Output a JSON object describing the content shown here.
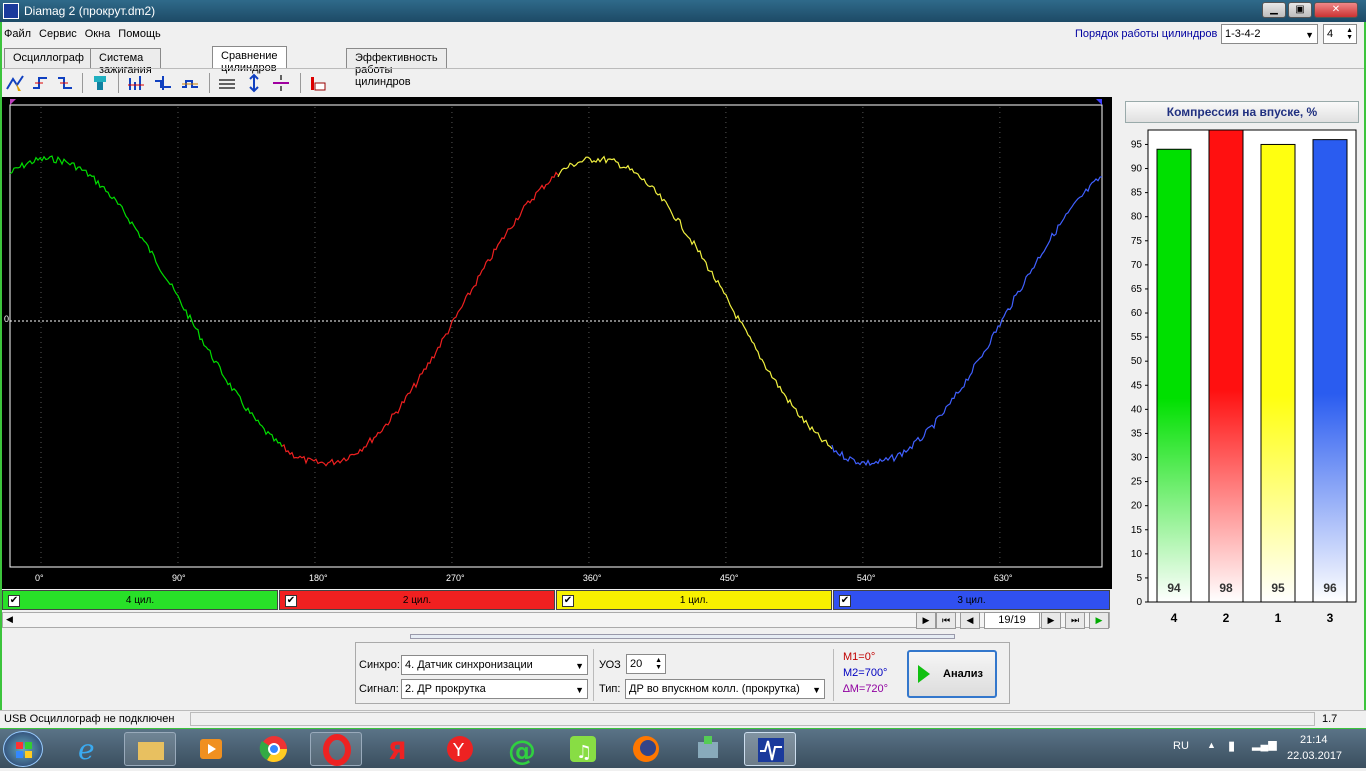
{
  "window": {
    "title": "Diamag 2 (прокрут.dm2)"
  },
  "menu": [
    "Файл",
    "Сервис",
    "Окна",
    "Помощь"
  ],
  "firing_order": {
    "label": "Порядок работы цилиндров",
    "value": "1-3-4-2",
    "count": "4"
  },
  "tabs": [
    "Осциллограф",
    "Система зажигания",
    "Сравнение цилиндров",
    "Эффективность работы цилиндров"
  ],
  "active_tab": 2,
  "scope": {
    "zero_label": "0",
    "angle_ticks": [
      "0°",
      "90°",
      "180°",
      "270°",
      "360°",
      "450°",
      "540°",
      "630°"
    ],
    "cylinders": [
      {
        "label": "4 цил.",
        "color": "#00dd00",
        "bar": "#28e028"
      },
      {
        "label": "2 цил.",
        "color": "#ee2020",
        "bar": "#f02020"
      },
      {
        "label": "1 цил.",
        "color": "#f0f040",
        "bar": "#f8f000"
      },
      {
        "label": "3 цил.",
        "color": "#4060ff",
        "bar": "#3050f0"
      }
    ]
  },
  "navigation": {
    "page": "19/19"
  },
  "controls": {
    "sync_label": "Синхро:",
    "sync_value": "4. Датчик синхронизации",
    "signal_label": "Сигнал:",
    "signal_value": "2. ДР прокрутка",
    "uoz_label": "УОЗ",
    "uoz_value": "20",
    "type_label": "Тип:",
    "type_value": "ДР во впускном колл. (прокрутка)",
    "m1": "M1=0°",
    "m2": "M2=700°",
    "dm": "∆M=720°",
    "analyze": "Анализ"
  },
  "status": {
    "text": "USB Осциллограф не подключен",
    "version": "1.7"
  },
  "tray": {
    "lang": "RU",
    "time": "21:14",
    "date": "22.03.2017"
  },
  "chart_data": {
    "type": "bar",
    "title": "Компрессия на впуске, %",
    "categories": [
      "4",
      "2",
      "1",
      "3"
    ],
    "values": [
      94,
      98,
      95,
      96
    ],
    "colors": [
      "#00e000",
      "#ff1010",
      "#ffff10",
      "#2a5cf0"
    ],
    "ylim": [
      0,
      98
    ],
    "yticks": [
      0,
      5,
      10,
      15,
      20,
      25,
      30,
      35,
      40,
      45,
      50,
      55,
      60,
      65,
      70,
      75,
      80,
      85,
      90,
      95
    ]
  }
}
